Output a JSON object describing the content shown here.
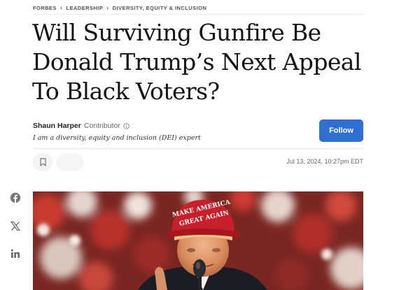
{
  "breadcrumb": [
    "FORBES",
    "LEADERSHIP",
    "DIVERSITY, EQUITY & INCLUSION"
  ],
  "headline": {
    "line1": "Will Surviving Gunfire Be",
    "line2": "Donald Trump’s Next Appeal",
    "line3": "To Black Voters?"
  },
  "author": {
    "name": "Shaun Harper",
    "role": "Contributor",
    "bio": "I am a diversity, equity and inclusion (DEI) expert"
  },
  "follow_label": "Follow",
  "dateline": "Jul 13, 2024, 10:27pm EDT",
  "hero": {
    "hat_line1": "MAKE AMERICA",
    "hat_line2": "GREAT AGAIN"
  },
  "social_icons": [
    "facebook-icon",
    "x-icon",
    "linkedin-icon"
  ],
  "colors": {
    "follow_button": "#2f6fd1",
    "hat_red": "#c8202a"
  }
}
